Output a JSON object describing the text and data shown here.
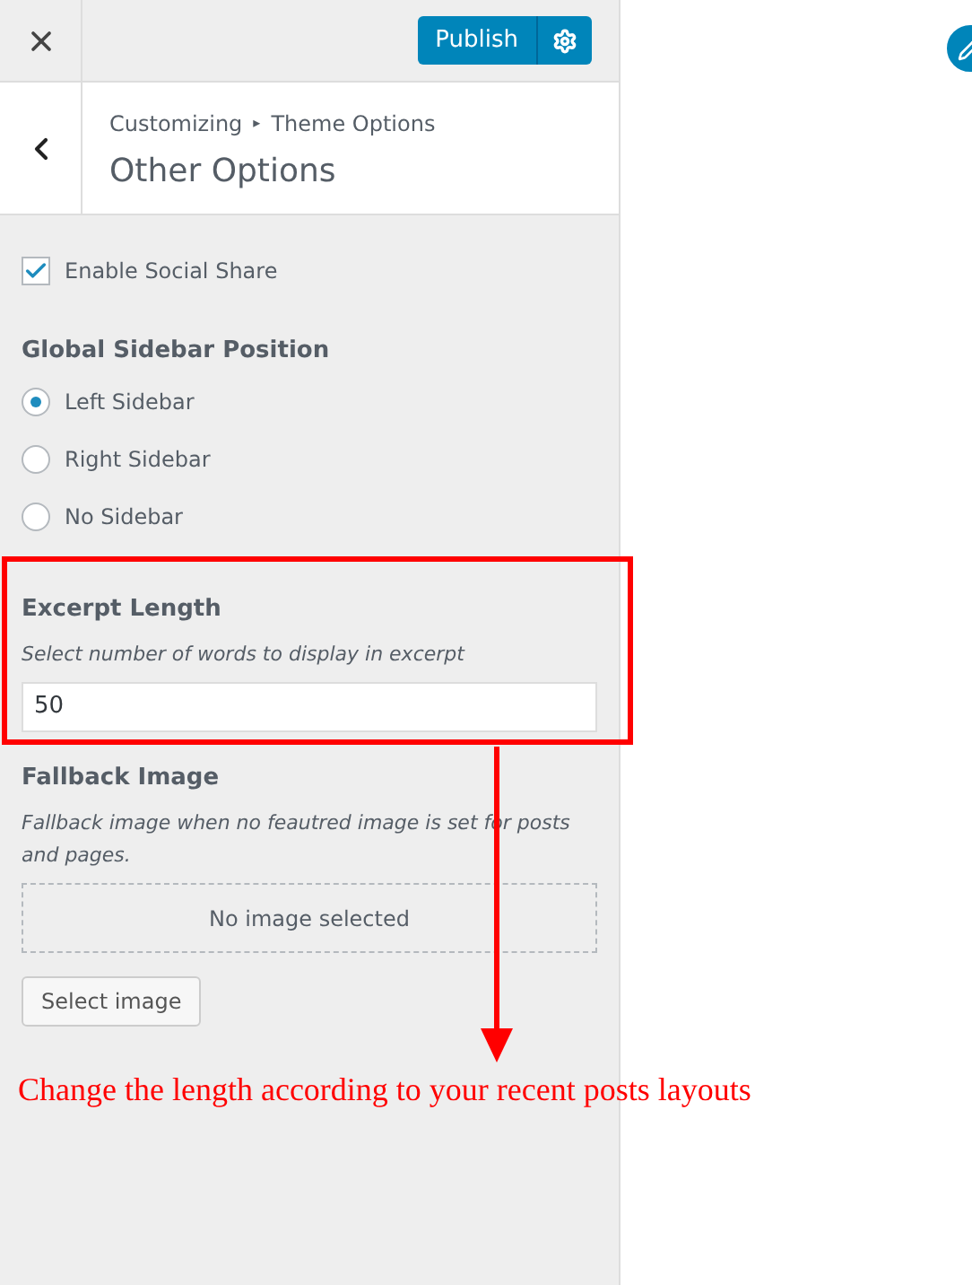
{
  "header": {
    "publish_label": "Publish"
  },
  "section": {
    "breadcrumb_root": "Customizing",
    "breadcrumb_sep": "▸",
    "breadcrumb_parent": "Theme Options",
    "title": "Other Options"
  },
  "social_share": {
    "label": "Enable Social Share",
    "checked": true
  },
  "sidebar_position": {
    "title": "Global Sidebar Position",
    "options": [
      {
        "label": "Left Sidebar",
        "selected": true
      },
      {
        "label": "Right Sidebar",
        "selected": false
      },
      {
        "label": "No Sidebar",
        "selected": false
      }
    ]
  },
  "excerpt": {
    "title": "Excerpt Length",
    "description": "Select number of words to display in excerpt",
    "value": "50"
  },
  "fallback_image": {
    "title": "Fallback Image",
    "description": "Fallback image when no feautred image is set for posts and pages.",
    "placeholder": "No image selected",
    "button": "Select image"
  },
  "annotation": {
    "note": "Change the length according to your recent posts layouts"
  }
}
